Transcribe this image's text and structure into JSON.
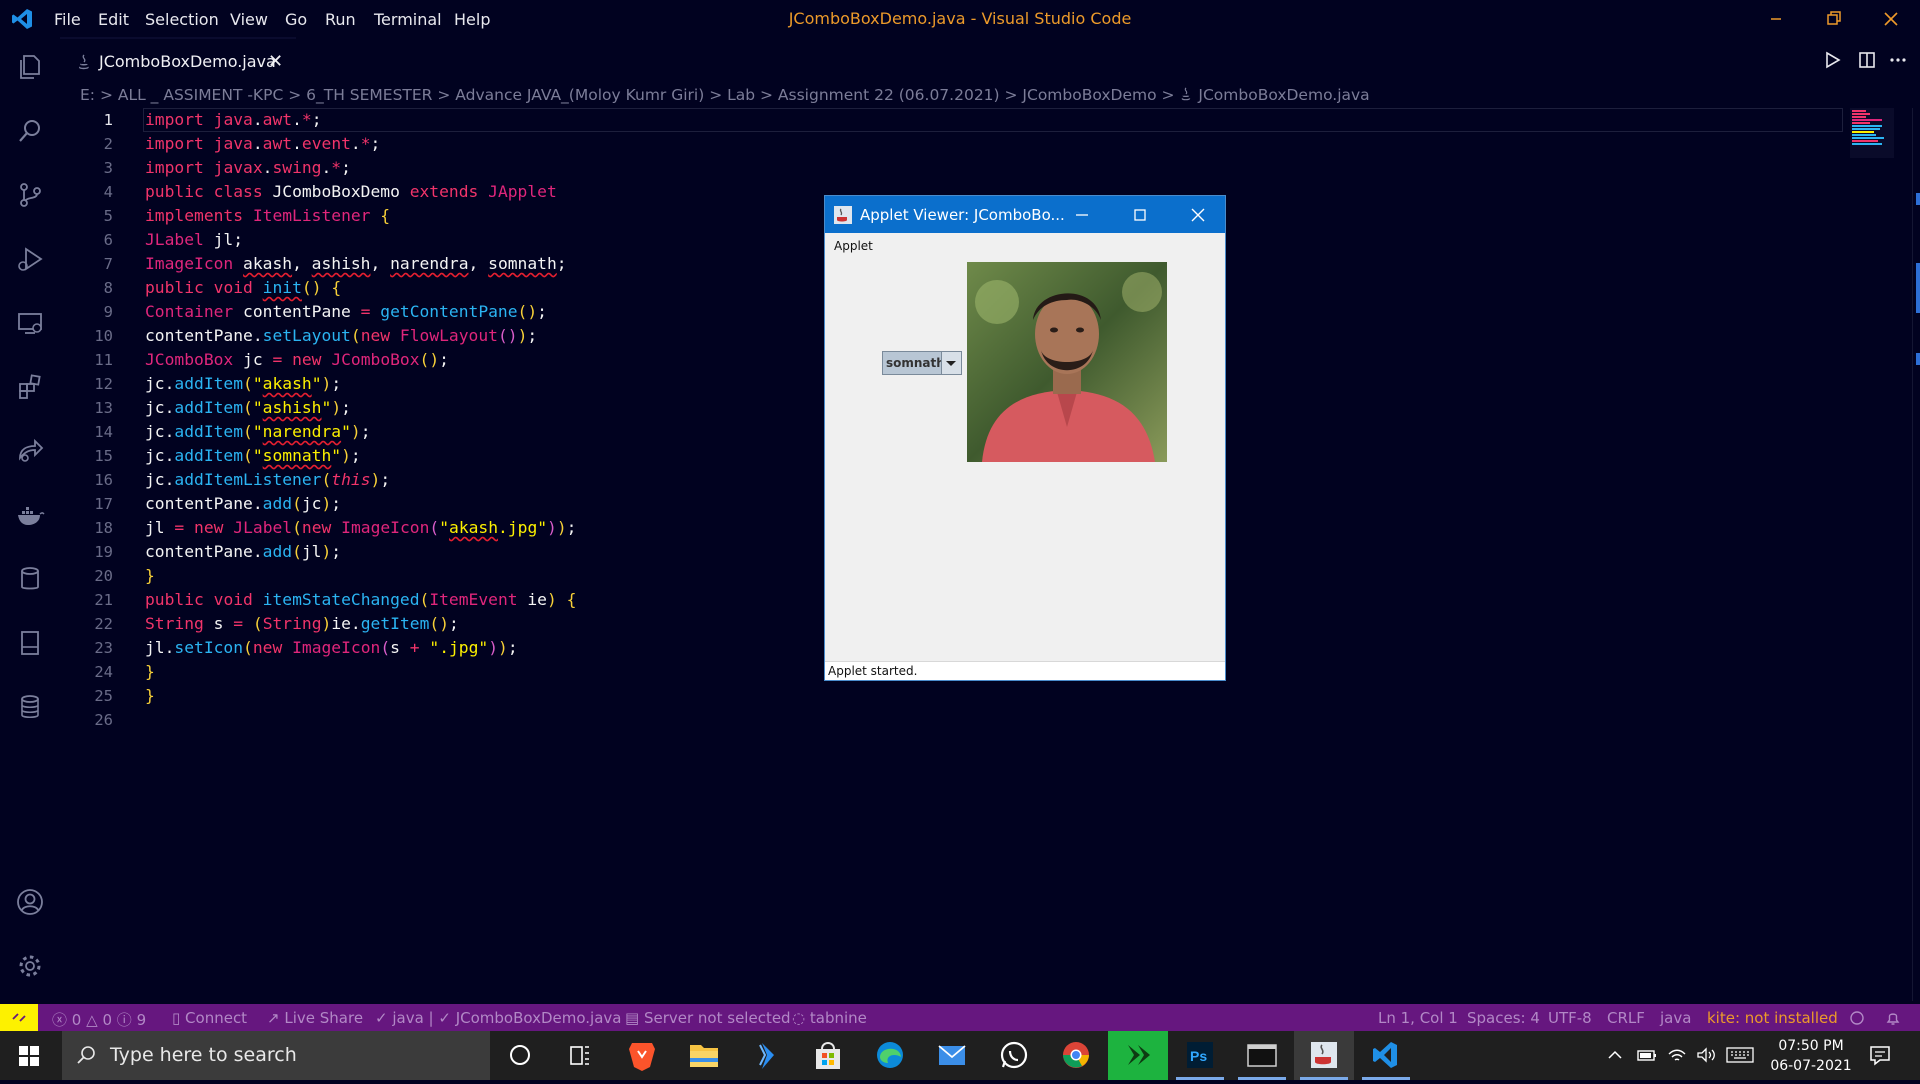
{
  "window": {
    "title": "JComboBoxDemo.java - Visual Studio Code",
    "menu": [
      "File",
      "Edit",
      "Selection",
      "View",
      "Go",
      "Run",
      "Terminal",
      "Help"
    ]
  },
  "tab": {
    "label": "JComboBoxDemo.java",
    "close": "✕"
  },
  "breadcrumb": [
    "E:",
    "ALL _ ASSIMENT -KPC",
    "6_TH SEMESTER",
    "Advance JAVA_(Moloy Kumr Giri)",
    "Lab",
    "Assignment 22 (06.07.2021)",
    "JComboBoxDemo",
    "JComboBoxDemo.java"
  ],
  "breadcrumb_text": "E: > ALL _ ASSIMENT -KPC > 6_TH SEMESTER > Advance JAVA_(Moloy Kumr Giri) > Lab > Assignment 22 (06.07.2021) > JComboBoxDemo > ",
  "breadcrumb_file": "JComboBoxDemo.java",
  "editor": {
    "line_numbers": [
      "1",
      "2",
      "3",
      "4",
      "5",
      "6",
      "7",
      "8",
      "9",
      "10",
      "11",
      "12",
      "13",
      "14",
      "15",
      "16",
      "17",
      "18",
      "19",
      "20",
      "21",
      "22",
      "23",
      "24",
      "25",
      "26"
    ],
    "lines": [
      "import java.awt.*;",
      "import java.awt.event.*;",
      "import javax.swing.*;",
      "public class JComboBoxDemo extends JApplet",
      "implements ItemListener {",
      "JLabel jl;",
      "ImageIcon akash, ashish, narendra, somnath;",
      "public void init() {",
      "Container contentPane = getContentPane();",
      "contentPane.setLayout(new FlowLayout());",
      "JComboBox jc = new JComboBox();",
      "jc.addItem(\"akash\");",
      "jc.addItem(\"ashish\");",
      "jc.addItem(\"narendra\");",
      "jc.addItem(\"somnath\");",
      "jc.addItemListener(this);",
      "contentPane.add(jc);",
      "jl = new JLabel(new ImageIcon(\"akash.jpg\"));",
      "contentPane.add(jl);",
      "}",
      "public void itemStateChanged(ItemEvent ie) {",
      "String s = (String)ie.getItem();",
      "jl.setIcon(new ImageIcon(s + \".jpg\"));",
      "}",
      "}",
      ""
    ]
  },
  "applet": {
    "title": "Applet Viewer: JComboBo...",
    "menu": "Applet",
    "combo_value": "somnath",
    "status": "Applet started."
  },
  "statusbar": {
    "problems": "0",
    "warnings": "0",
    "info": "9",
    "connect": "Connect",
    "live_share": "Live Share",
    "java_status": "java | ✓ JComboBoxDemo.java",
    "server": "Server not selected",
    "tabnine": "tabnine",
    "position": "Ln 1, Col 1",
    "spaces": "Spaces: 4",
    "encoding": "UTF-8",
    "eol": "CRLF",
    "language": "java",
    "kite": "kite: not installed"
  },
  "taskbar": {
    "search_placeholder": "Type here to search",
    "time": "07:50 PM",
    "date": "06-07-2021",
    "apps": [
      "cortana-icon",
      "task-view-icon",
      "brave-icon",
      "file-explorer-icon",
      "visual-studio-icon",
      "store-icon",
      "edge-icon",
      "mail-icon",
      "whatsapp-icon",
      "chrome-icon",
      "jdownloader-icon",
      "photoshop-icon",
      "terminal-icon",
      "java-applet-icon",
      "vscode-icon"
    ]
  },
  "colors": {
    "background": "#010220",
    "statusbar": "#66177f",
    "accent": "#0b6fcc",
    "keyword": "#f1346a",
    "function": "#2bb4f2",
    "string": "#fdf100",
    "title": "#ec9a2a"
  }
}
